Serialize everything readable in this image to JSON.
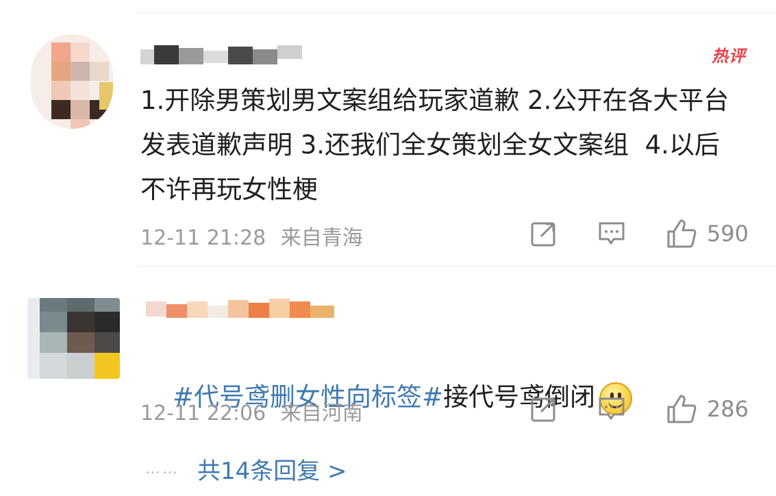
{
  "comments": [
    {
      "hot_badge": "热评",
      "text": "1.开除男策划男文案组给玩家道歉 2.公开在各大平台发表道歉声明 3.还我们全女策划全女文案组  4.以后不许再玩女性梗",
      "time": "12-11 21:28",
      "location": "来自青海",
      "likes": "590"
    },
    {
      "topic": "#代号鸢删女性向标签#",
      "text": "接代号鸢倒闭",
      "emoji": "smiley-emoji",
      "time": "12-11 22:06",
      "location": "来自河南",
      "likes": "286"
    }
  ],
  "replies": {
    "dots": "……",
    "label": "共14条回复 >"
  },
  "colors": {
    "link": "#3f7ab0",
    "hot": "#e8434b",
    "meta": "#9a9a9a"
  },
  "icons": [
    "forward-icon",
    "comment-icon",
    "like-icon"
  ]
}
